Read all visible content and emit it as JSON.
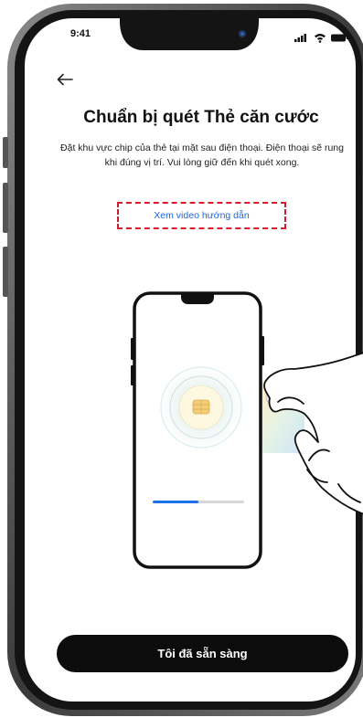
{
  "status_bar": {
    "time": "9:41",
    "icons": [
      "signal-icon",
      "wifi-icon",
      "battery-icon"
    ]
  },
  "nav": {
    "back_icon": "back-arrow-icon"
  },
  "content": {
    "title": "Chuẩn bị quét Thẻ căn cước",
    "description": "Đặt khu vực chip của thẻ tại mặt sau điện thoại. Điện thoại sẽ rung khi đúng vị trí. Vui lòng giữ đến khi quét xong.",
    "video_link": "Xem video hướng dẫn"
  },
  "illustration": {
    "scan_progress": 0.5
  },
  "cta": {
    "label": "Tôi đã sẵn sàng"
  },
  "colors": {
    "link": "#1a67e0",
    "highlight_border": "#d21e2b",
    "cta_background": "#0c0c0c",
    "progress_fill": "#1a73e8",
    "progress_track": "#d7d7d7"
  }
}
